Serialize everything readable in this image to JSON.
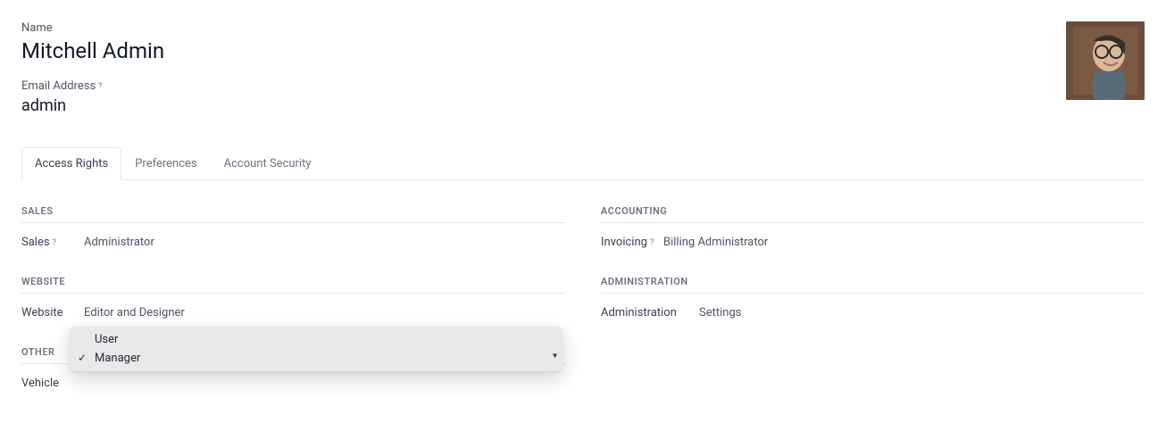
{
  "header": {
    "name_label": "Name",
    "name_value": "Mitchell Admin",
    "email_label": "Email Address",
    "email_value": "admin"
  },
  "tabs": {
    "access_rights": "Access Rights",
    "preferences": "Preferences",
    "account_security": "Account Security"
  },
  "sections": {
    "sales": {
      "title": "SALES",
      "rows": [
        {
          "label": "Sales",
          "value": "Administrator",
          "help": true
        }
      ]
    },
    "website": {
      "title": "WEBSITE",
      "rows": [
        {
          "label": "Website",
          "value": "Editor and Designer",
          "help": false
        }
      ]
    },
    "other": {
      "title": "OTHER",
      "rows": [
        {
          "label": "Vehicle",
          "value": "",
          "help": false
        }
      ]
    },
    "accounting": {
      "title": "ACCOUNTING",
      "rows": [
        {
          "label": "Invoicing",
          "value": "Billing Administrator",
          "help": true
        }
      ]
    },
    "administration": {
      "title": "ADMINISTRATION",
      "rows": [
        {
          "label": "Administration",
          "value": "Settings",
          "help": false
        }
      ]
    }
  },
  "dropdown": {
    "options": [
      {
        "label": "User",
        "selected": false
      },
      {
        "label": "Manager",
        "selected": true
      }
    ]
  },
  "help_glyph": "?"
}
